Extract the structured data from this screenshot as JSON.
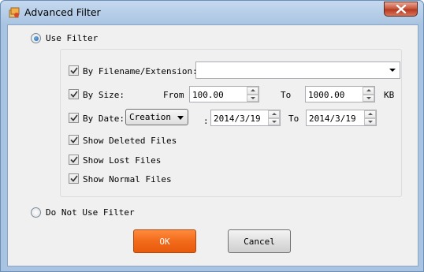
{
  "window": {
    "title": "Advanced Filter",
    "accent": "#f26a1b"
  },
  "filter_mode": {
    "use_filter_label": "Use Filter",
    "use_filter_selected": true,
    "no_filter_label": "Do Not Use Filter"
  },
  "by_filename": {
    "label": "By Filename/Extension:",
    "checked": true,
    "value": ""
  },
  "by_size": {
    "label": "By Size:",
    "checked": true,
    "from_label": "From",
    "from_value": "100.00",
    "to_label": "To",
    "to_value": "1000.00",
    "unit": "KB"
  },
  "by_date": {
    "label": "By Date:",
    "checked": true,
    "type_value": "Creation",
    "separator": ":",
    "from_value": "2014/3/19",
    "to_label": "To",
    "to_value": "2014/3/19"
  },
  "options": {
    "deleted": {
      "label": "Show Deleted Files",
      "checked": true
    },
    "lost": {
      "label": "Show Lost Files",
      "checked": true
    },
    "normal": {
      "label": "Show Normal Files",
      "checked": true
    }
  },
  "buttons": {
    "ok": "OK",
    "cancel": "Cancel"
  }
}
